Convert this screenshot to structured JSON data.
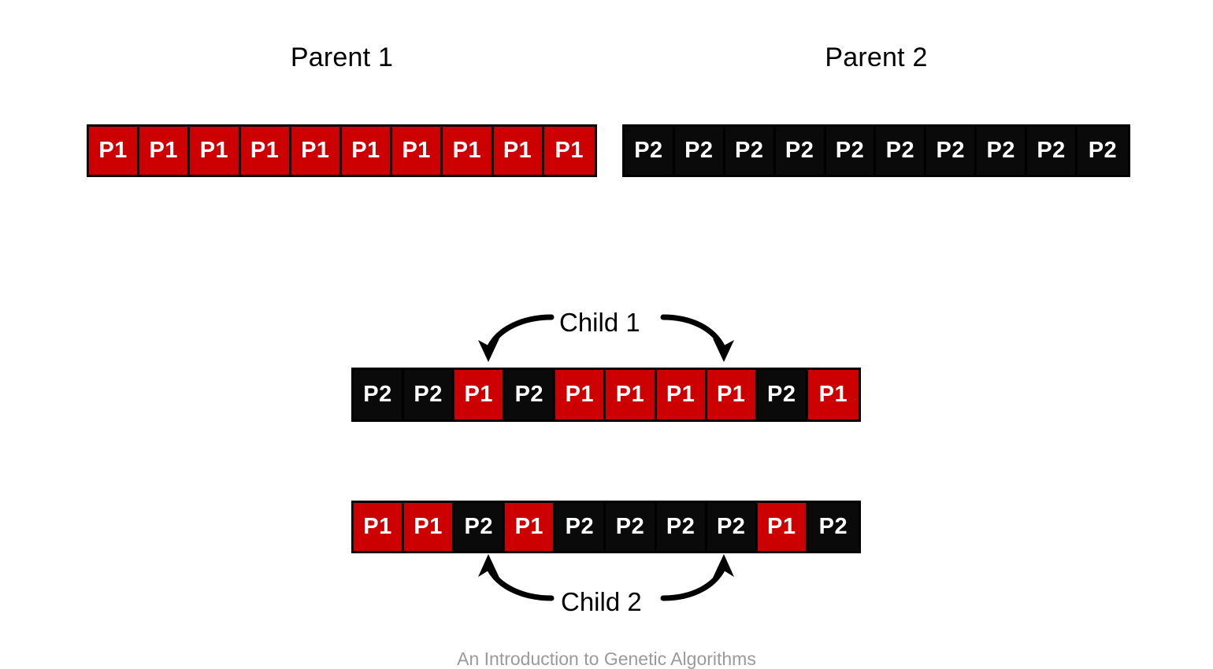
{
  "figure": {
    "footer_caption": "An Introduction to Genetic Algorithms",
    "colors": {
      "parent1_cell": "#CC0000",
      "parent2_cell": "#0A0A0A",
      "border": "#000000",
      "label_text": "#FFFFFF",
      "background": "#FFFFFF",
      "footer_text": "#9A9A9A"
    }
  },
  "parents": [
    {
      "heading": "Parent 1",
      "genes": [
        {
          "label": "P1",
          "source": "p1"
        },
        {
          "label": "P1",
          "source": "p1"
        },
        {
          "label": "P1",
          "source": "p1"
        },
        {
          "label": "P1",
          "source": "p1"
        },
        {
          "label": "P1",
          "source": "p1"
        },
        {
          "label": "P1",
          "source": "p1"
        },
        {
          "label": "P1",
          "source": "p1"
        },
        {
          "label": "P1",
          "source": "p1"
        },
        {
          "label": "P1",
          "source": "p1"
        },
        {
          "label": "P1",
          "source": "p1"
        }
      ]
    },
    {
      "heading": "Parent 2",
      "genes": [
        {
          "label": "P2",
          "source": "p2"
        },
        {
          "label": "P2",
          "source": "p2"
        },
        {
          "label": "P2",
          "source": "p2"
        },
        {
          "label": "P2",
          "source": "p2"
        },
        {
          "label": "P2",
          "source": "p2"
        },
        {
          "label": "P2",
          "source": "p2"
        },
        {
          "label": "P2",
          "source": "p2"
        },
        {
          "label": "P2",
          "source": "p2"
        },
        {
          "label": "P2",
          "source": "p2"
        },
        {
          "label": "P2",
          "source": "p2"
        }
      ]
    }
  ],
  "children": [
    {
      "label": "Child 1",
      "arrow_direction": "down",
      "arrow_target_positions": [
        3,
        8
      ],
      "genes": [
        {
          "label": "P2",
          "source": "p2"
        },
        {
          "label": "P2",
          "source": "p2"
        },
        {
          "label": "P1",
          "source": "p1"
        },
        {
          "label": "P2",
          "source": "p2"
        },
        {
          "label": "P1",
          "source": "p1"
        },
        {
          "label": "P1",
          "source": "p1"
        },
        {
          "label": "P1",
          "source": "p1"
        },
        {
          "label": "P1",
          "source": "p1"
        },
        {
          "label": "P2",
          "source": "p2"
        },
        {
          "label": "P1",
          "source": "p1"
        }
      ]
    },
    {
      "label": "Child 2",
      "arrow_direction": "up",
      "arrow_target_positions": [
        3,
        8
      ],
      "genes": [
        {
          "label": "P1",
          "source": "p1"
        },
        {
          "label": "P1",
          "source": "p1"
        },
        {
          "label": "P2",
          "source": "p2"
        },
        {
          "label": "P1",
          "source": "p1"
        },
        {
          "label": "P2",
          "source": "p2"
        },
        {
          "label": "P2",
          "source": "p2"
        },
        {
          "label": "P2",
          "source": "p2"
        },
        {
          "label": "P2",
          "source": "p2"
        },
        {
          "label": "P1",
          "source": "p1"
        },
        {
          "label": "P2",
          "source": "p2"
        }
      ]
    }
  ]
}
